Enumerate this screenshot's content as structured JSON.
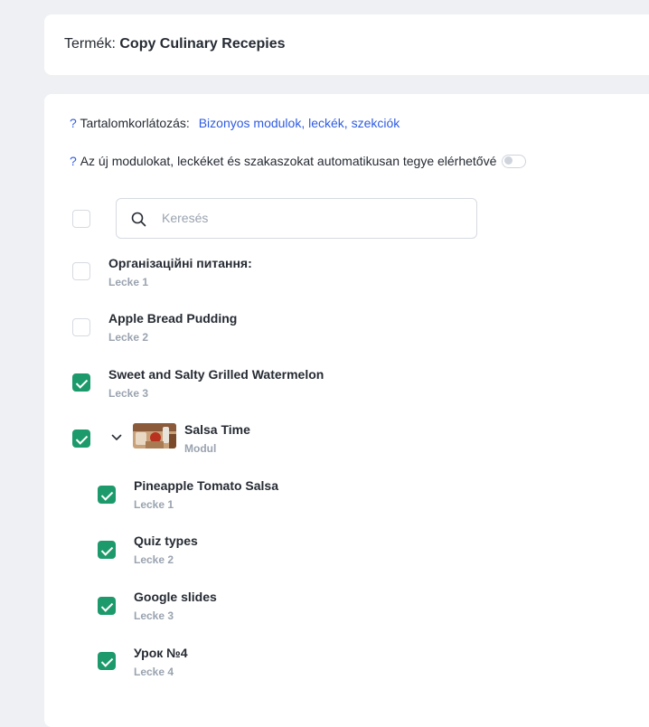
{
  "product": {
    "label": "Termék:",
    "name": "Copy Culinary Recepies"
  },
  "restriction": {
    "help": "?",
    "label": "Tartalomkorlátozás:",
    "value": "Bizonyos modulok, leckék, szekciók"
  },
  "auto_access": {
    "help": "?",
    "label": "Az új modulokat, leckéket és szakaszokat automatikusan tegye elérhetővé",
    "enabled": false
  },
  "search": {
    "placeholder": "Keresés",
    "value": ""
  },
  "items": [
    {
      "title": "Організаційні питання:",
      "sub": "Lecke 1",
      "checked": false
    },
    {
      "title": "Apple Bread Pudding",
      "sub": "Lecke 2",
      "checked": false
    },
    {
      "title": "Sweet and Salty Grilled Watermelon",
      "sub": "Lecke 3",
      "checked": true
    },
    {
      "title": "Salsa Time",
      "sub": "Modul",
      "checked": true,
      "expanded": true
    }
  ],
  "module_items": [
    {
      "title": "Pineapple Tomato Salsa",
      "sub": "Lecke 1",
      "checked": true
    },
    {
      "title": "Quiz types",
      "sub": "Lecke 2",
      "checked": true
    },
    {
      "title": "Google slides",
      "sub": "Lecke 3",
      "checked": true
    },
    {
      "title": "Урок №4",
      "sub": "Lecke 4",
      "checked": true
    }
  ],
  "colors": {
    "accent": "#1d9a6c",
    "link": "#2f5ce0",
    "muted": "#9aa3af",
    "background": "#eef0f3"
  }
}
